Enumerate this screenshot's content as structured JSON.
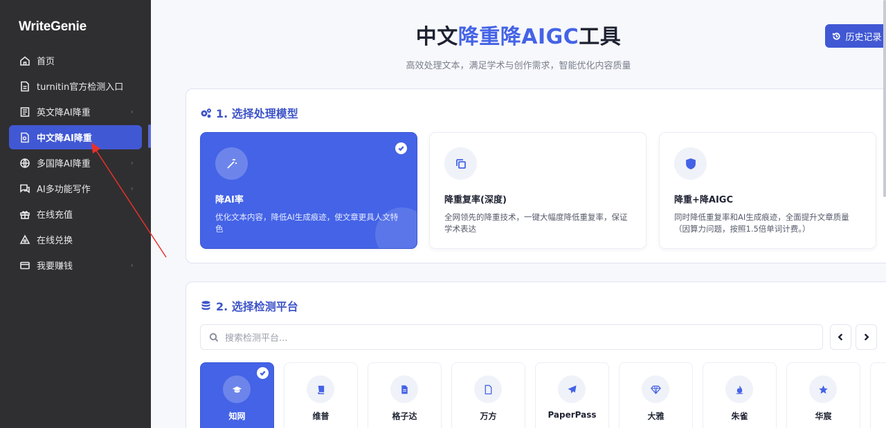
{
  "sidebar": {
    "brand": "WriteGenie",
    "items": [
      {
        "label": "首页",
        "icon": "home-icon",
        "chevron": false,
        "active": false
      },
      {
        "label": "turnitin官方检测入口",
        "icon": "document-icon",
        "chevron": false,
        "active": false
      },
      {
        "label": "英文降AI降重",
        "icon": "book-icon",
        "chevron": true,
        "active": false
      },
      {
        "label": "中文降AI降重",
        "icon": "file-search-icon",
        "chevron": false,
        "active": true
      },
      {
        "label": "多国降AI降重",
        "icon": "globe-icon",
        "chevron": true,
        "active": false
      },
      {
        "label": "AI多功能写作",
        "icon": "chat-icon",
        "chevron": true,
        "active": false
      },
      {
        "label": "在线充值",
        "icon": "gift-icon",
        "chevron": false,
        "active": false
      },
      {
        "label": "在线兑换",
        "icon": "exchange-icon",
        "chevron": false,
        "active": false
      },
      {
        "label": "我要赚钱",
        "icon": "wallet-icon",
        "chevron": true,
        "active": false
      }
    ]
  },
  "header": {
    "title_part1": "中文",
    "title_highlight": "降重降AIGC",
    "title_part2": "工具",
    "subtitle": "高效处理文本，满足学术与创作需求，智能优化内容质量",
    "history_label": "历史记录"
  },
  "step1": {
    "title": "1. 选择处理模型",
    "models": [
      {
        "name": "降AI率",
        "desc": "优化文本内容，降低AI生成痕迹，使文章更具人文特色",
        "icon": "magic-wand-icon",
        "selected": true
      },
      {
        "name": "降重复率(深度)",
        "desc": "全网领先的降重技术，一键大幅度降低重复率，保证学术表达",
        "icon": "copy-icon",
        "selected": false
      },
      {
        "name": "降重+降AIGC",
        "desc": "同时降低重复率和AI生成痕迹，全面提升文章质量（因算力问题，按照1.5倍单词计费。）",
        "icon": "shield-icon",
        "selected": false
      }
    ]
  },
  "step2": {
    "title": "2. 选择检测平台",
    "search_placeholder": "搜索检测平台...",
    "platforms": [
      {
        "name": "知网",
        "icon": "graduation-cap-icon",
        "selected": true
      },
      {
        "name": "维普",
        "icon": "book-icon",
        "selected": false
      },
      {
        "name": "格子达",
        "icon": "file-text-icon",
        "selected": false
      },
      {
        "name": "万方",
        "icon": "file-icon",
        "selected": false
      },
      {
        "name": "PaperPass",
        "icon": "paper-plane-icon",
        "selected": false
      },
      {
        "name": "大雅",
        "icon": "gem-icon",
        "selected": false
      },
      {
        "name": "朱雀",
        "icon": "flame-icon",
        "selected": false
      },
      {
        "name": "华宸",
        "icon": "star-icon",
        "selected": false
      }
    ]
  },
  "colors": {
    "accent": "#4463e6",
    "sidebar_bg": "#2f2f31",
    "active_bg": "#4158d4",
    "annotation": "#e8312b"
  }
}
